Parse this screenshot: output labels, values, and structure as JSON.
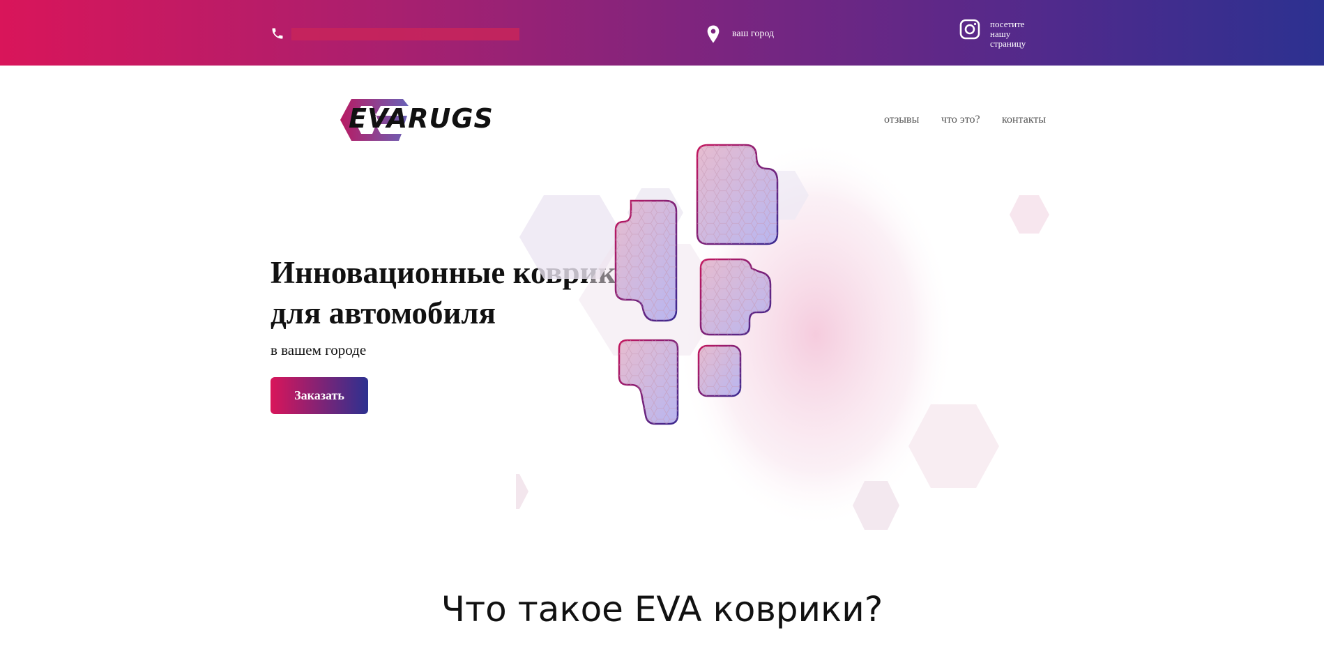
{
  "topbar": {
    "city": "ваш город",
    "instagram_text": "посетите нашу страницу"
  },
  "brand": {
    "name": "EVARUGS"
  },
  "nav": [
    {
      "label": "отзывы"
    },
    {
      "label": "что это?"
    },
    {
      "label": "контакты"
    }
  ],
  "hero": {
    "title": "Инновационные коврики для автомобиля",
    "subtitle": "в вашем городе",
    "cta": "Заказать"
  },
  "section": {
    "title": "Что такое EVA коврики?"
  },
  "colors": {
    "accent_start": "#d9155a",
    "accent_end": "#2c3190"
  },
  "icons": [
    "phone-icon",
    "map-pin-icon",
    "instagram-icon",
    "logo-hexagon-icon"
  ]
}
